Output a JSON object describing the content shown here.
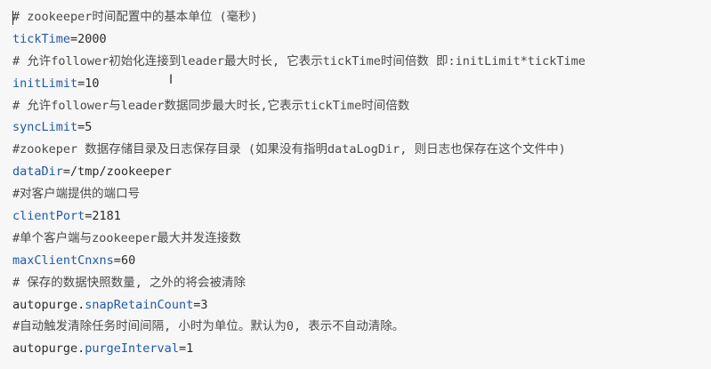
{
  "lines": [
    {
      "type": "comment",
      "text": "# zookeeper时间配置中的基本单位 (毫秒)"
    },
    {
      "type": "kv",
      "key": "tickTime",
      "value": "2000"
    },
    {
      "type": "comment",
      "text": "# 允许follower初始化连接到leader最大时长, 它表示tickTime时间倍数 即:initLimit*tickTime"
    },
    {
      "type": "kv",
      "key": "initLimit",
      "value": "10"
    },
    {
      "type": "comment",
      "text": "# 允许follower与leader数据同步最大时长,它表示tickTime时间倍数"
    },
    {
      "type": "kv",
      "key": "syncLimit",
      "value": "5"
    },
    {
      "type": "comment",
      "text": "#zookeper 数据存储目录及日志保存目录 (如果没有指明dataLogDir, 则日志也保存在这个文件中)"
    },
    {
      "type": "kv",
      "key": "dataDir",
      "value": "/tmp/zookeeper"
    },
    {
      "type": "comment",
      "text": "#对客户端提供的端口号"
    },
    {
      "type": "kv",
      "key": "clientPort",
      "value": "2181"
    },
    {
      "type": "comment",
      "text": "#单个客户端与zookeeper最大并发连接数"
    },
    {
      "type": "kv",
      "key": "maxClientCnxns",
      "value": "60"
    },
    {
      "type": "comment",
      "text": "# 保存的数据快照数量, 之外的将会被清除"
    },
    {
      "type": "kvp",
      "prefix": "autopurge.",
      "key": "snapRetainCount",
      "value": "3"
    },
    {
      "type": "comment",
      "text": "#自动触发清除任务时间间隔, 小时为单位。默认为0, 表示不自动清除。"
    },
    {
      "type": "kvp",
      "prefix": "autopurge.",
      "key": "purgeInterval",
      "value": "1"
    }
  ],
  "cursor_icon": "i-beam-cursor-icon",
  "colors": {
    "background": "#f7f7f7",
    "key": "#1f5aa8",
    "text": "#2b2b2b"
  }
}
